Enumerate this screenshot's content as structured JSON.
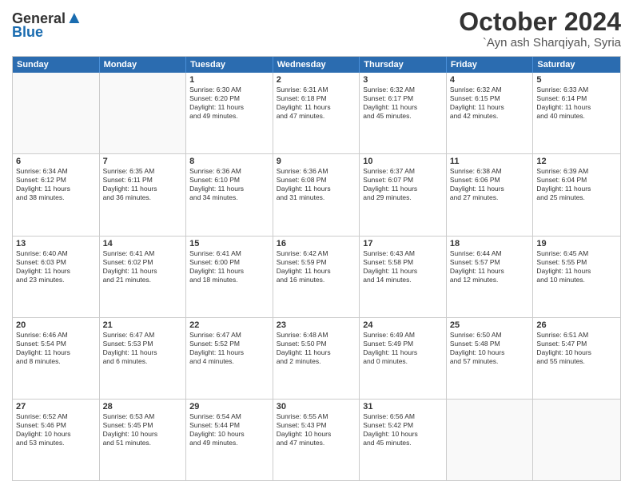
{
  "header": {
    "logo_line1": "General",
    "logo_line2": "Blue",
    "month": "October 2024",
    "location": "`Ayn ash Sharqiyah, Syria"
  },
  "days_of_week": [
    "Sunday",
    "Monday",
    "Tuesday",
    "Wednesday",
    "Thursday",
    "Friday",
    "Saturday"
  ],
  "weeks": [
    [
      {
        "day": "",
        "empty": true
      },
      {
        "day": "",
        "empty": true
      },
      {
        "day": "1",
        "lines": [
          "Sunrise: 6:30 AM",
          "Sunset: 6:20 PM",
          "Daylight: 11 hours",
          "and 49 minutes."
        ]
      },
      {
        "day": "2",
        "lines": [
          "Sunrise: 6:31 AM",
          "Sunset: 6:18 PM",
          "Daylight: 11 hours",
          "and 47 minutes."
        ]
      },
      {
        "day": "3",
        "lines": [
          "Sunrise: 6:32 AM",
          "Sunset: 6:17 PM",
          "Daylight: 11 hours",
          "and 45 minutes."
        ]
      },
      {
        "day": "4",
        "lines": [
          "Sunrise: 6:32 AM",
          "Sunset: 6:15 PM",
          "Daylight: 11 hours",
          "and 42 minutes."
        ]
      },
      {
        "day": "5",
        "lines": [
          "Sunrise: 6:33 AM",
          "Sunset: 6:14 PM",
          "Daylight: 11 hours",
          "and 40 minutes."
        ]
      }
    ],
    [
      {
        "day": "6",
        "lines": [
          "Sunrise: 6:34 AM",
          "Sunset: 6:12 PM",
          "Daylight: 11 hours",
          "and 38 minutes."
        ]
      },
      {
        "day": "7",
        "lines": [
          "Sunrise: 6:35 AM",
          "Sunset: 6:11 PM",
          "Daylight: 11 hours",
          "and 36 minutes."
        ]
      },
      {
        "day": "8",
        "lines": [
          "Sunrise: 6:36 AM",
          "Sunset: 6:10 PM",
          "Daylight: 11 hours",
          "and 34 minutes."
        ]
      },
      {
        "day": "9",
        "lines": [
          "Sunrise: 6:36 AM",
          "Sunset: 6:08 PM",
          "Daylight: 11 hours",
          "and 31 minutes."
        ]
      },
      {
        "day": "10",
        "lines": [
          "Sunrise: 6:37 AM",
          "Sunset: 6:07 PM",
          "Daylight: 11 hours",
          "and 29 minutes."
        ]
      },
      {
        "day": "11",
        "lines": [
          "Sunrise: 6:38 AM",
          "Sunset: 6:06 PM",
          "Daylight: 11 hours",
          "and 27 minutes."
        ]
      },
      {
        "day": "12",
        "lines": [
          "Sunrise: 6:39 AM",
          "Sunset: 6:04 PM",
          "Daylight: 11 hours",
          "and 25 minutes."
        ]
      }
    ],
    [
      {
        "day": "13",
        "lines": [
          "Sunrise: 6:40 AM",
          "Sunset: 6:03 PM",
          "Daylight: 11 hours",
          "and 23 minutes."
        ]
      },
      {
        "day": "14",
        "lines": [
          "Sunrise: 6:41 AM",
          "Sunset: 6:02 PM",
          "Daylight: 11 hours",
          "and 21 minutes."
        ]
      },
      {
        "day": "15",
        "lines": [
          "Sunrise: 6:41 AM",
          "Sunset: 6:00 PM",
          "Daylight: 11 hours",
          "and 18 minutes."
        ]
      },
      {
        "day": "16",
        "lines": [
          "Sunrise: 6:42 AM",
          "Sunset: 5:59 PM",
          "Daylight: 11 hours",
          "and 16 minutes."
        ]
      },
      {
        "day": "17",
        "lines": [
          "Sunrise: 6:43 AM",
          "Sunset: 5:58 PM",
          "Daylight: 11 hours",
          "and 14 minutes."
        ]
      },
      {
        "day": "18",
        "lines": [
          "Sunrise: 6:44 AM",
          "Sunset: 5:57 PM",
          "Daylight: 11 hours",
          "and 12 minutes."
        ]
      },
      {
        "day": "19",
        "lines": [
          "Sunrise: 6:45 AM",
          "Sunset: 5:55 PM",
          "Daylight: 11 hours",
          "and 10 minutes."
        ]
      }
    ],
    [
      {
        "day": "20",
        "lines": [
          "Sunrise: 6:46 AM",
          "Sunset: 5:54 PM",
          "Daylight: 11 hours",
          "and 8 minutes."
        ]
      },
      {
        "day": "21",
        "lines": [
          "Sunrise: 6:47 AM",
          "Sunset: 5:53 PM",
          "Daylight: 11 hours",
          "and 6 minutes."
        ]
      },
      {
        "day": "22",
        "lines": [
          "Sunrise: 6:47 AM",
          "Sunset: 5:52 PM",
          "Daylight: 11 hours",
          "and 4 minutes."
        ]
      },
      {
        "day": "23",
        "lines": [
          "Sunrise: 6:48 AM",
          "Sunset: 5:50 PM",
          "Daylight: 11 hours",
          "and 2 minutes."
        ]
      },
      {
        "day": "24",
        "lines": [
          "Sunrise: 6:49 AM",
          "Sunset: 5:49 PM",
          "Daylight: 11 hours",
          "and 0 minutes."
        ]
      },
      {
        "day": "25",
        "lines": [
          "Sunrise: 6:50 AM",
          "Sunset: 5:48 PM",
          "Daylight: 10 hours",
          "and 57 minutes."
        ]
      },
      {
        "day": "26",
        "lines": [
          "Sunrise: 6:51 AM",
          "Sunset: 5:47 PM",
          "Daylight: 10 hours",
          "and 55 minutes."
        ]
      }
    ],
    [
      {
        "day": "27",
        "lines": [
          "Sunrise: 6:52 AM",
          "Sunset: 5:46 PM",
          "Daylight: 10 hours",
          "and 53 minutes."
        ]
      },
      {
        "day": "28",
        "lines": [
          "Sunrise: 6:53 AM",
          "Sunset: 5:45 PM",
          "Daylight: 10 hours",
          "and 51 minutes."
        ]
      },
      {
        "day": "29",
        "lines": [
          "Sunrise: 6:54 AM",
          "Sunset: 5:44 PM",
          "Daylight: 10 hours",
          "and 49 minutes."
        ]
      },
      {
        "day": "30",
        "lines": [
          "Sunrise: 6:55 AM",
          "Sunset: 5:43 PM",
          "Daylight: 10 hours",
          "and 47 minutes."
        ]
      },
      {
        "day": "31",
        "lines": [
          "Sunrise: 6:56 AM",
          "Sunset: 5:42 PM",
          "Daylight: 10 hours",
          "and 45 minutes."
        ]
      },
      {
        "day": "",
        "empty": true
      },
      {
        "day": "",
        "empty": true
      }
    ]
  ]
}
